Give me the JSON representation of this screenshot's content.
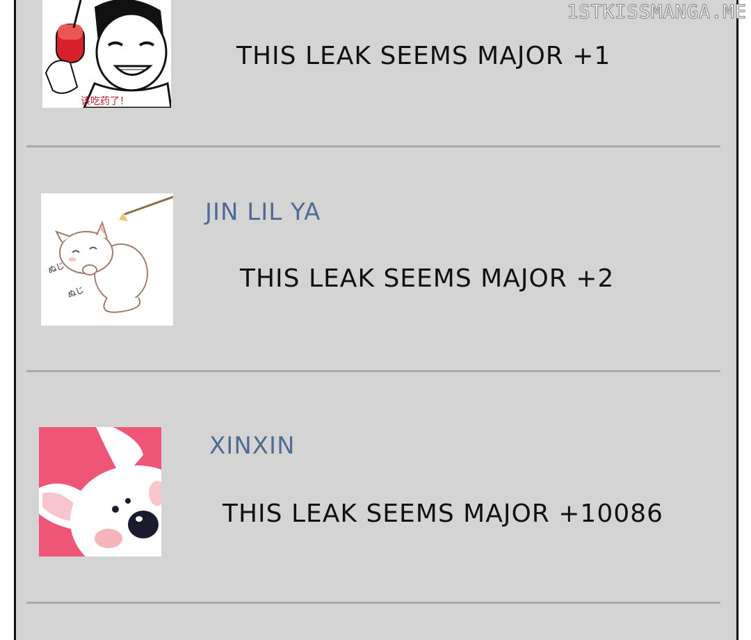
{
  "watermark": "1STKISSMANGA.ME",
  "comments": [
    {
      "username": "",
      "text": "THIS LEAK SEEMS MAJOR +1",
      "avatar_icon": "laughing-man-pill-avatar",
      "avatar_caption": "该吃药了！"
    },
    {
      "username": "JIN LIL YA",
      "text": "THIS LEAK SEEMS MAJOR +2",
      "avatar_icon": "white-cat-avatar"
    },
    {
      "username": "XINXIN",
      "text": "THIS LEAK SEEMS MAJOR +10086",
      "avatar_icon": "pink-bunny-avatar"
    }
  ],
  "colors": {
    "background": "#d4d4d4",
    "username": "#4e6c94",
    "text": "#111111",
    "divider": "#a9a9a9"
  }
}
